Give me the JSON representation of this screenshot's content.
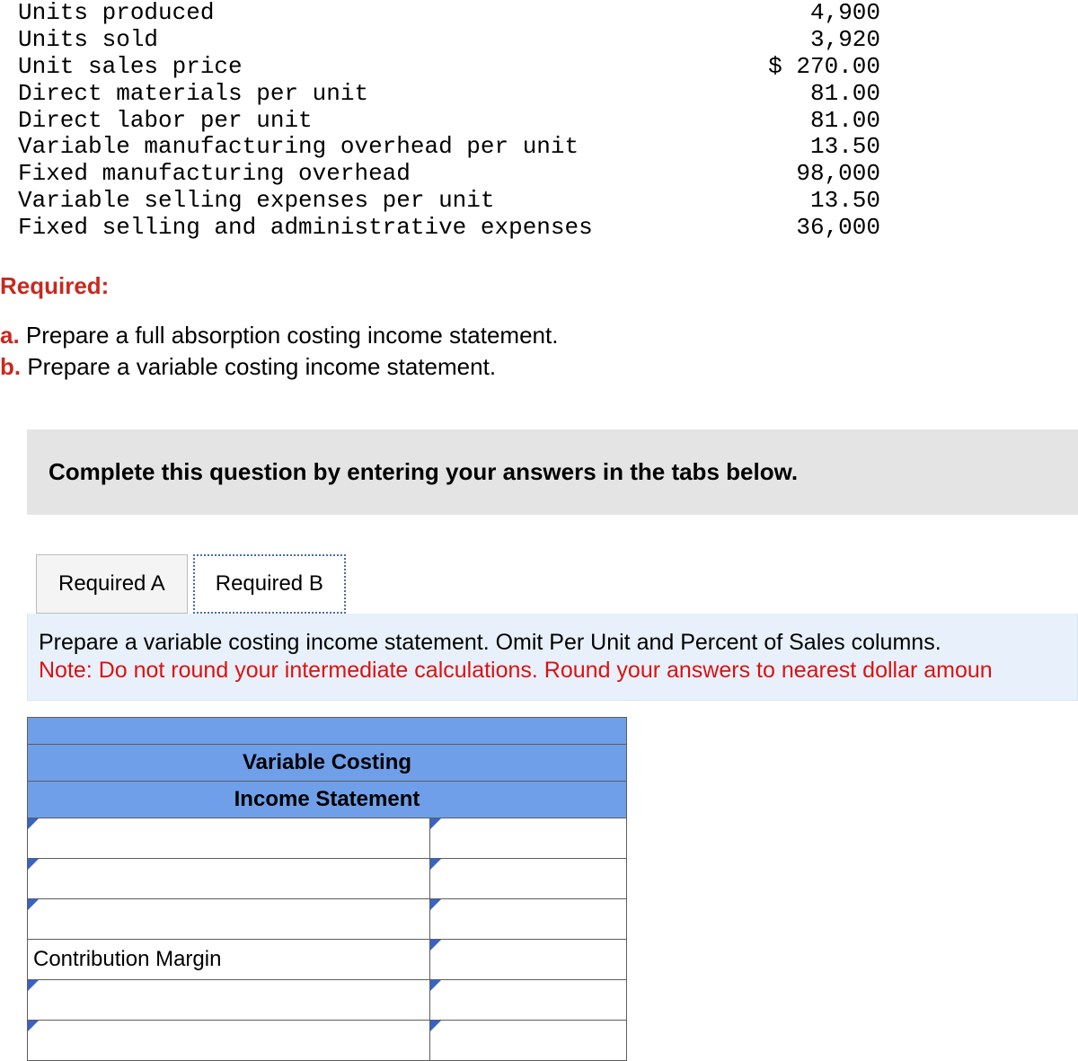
{
  "data_rows": [
    {
      "label": "Units produced",
      "value": "4,900"
    },
    {
      "label": "Units sold",
      "value": "3,920"
    },
    {
      "label": "Unit sales price",
      "value": "$ 270.00"
    },
    {
      "label": "Direct materials per unit",
      "value": "81.00"
    },
    {
      "label": "Direct labor per unit",
      "value": "81.00"
    },
    {
      "label": "Variable manufacturing overhead per unit",
      "value": "13.50"
    },
    {
      "label": "Fixed manufacturing overhead",
      "value": "98,000"
    },
    {
      "label": "Variable selling expenses per unit",
      "value": "13.50"
    },
    {
      "label": "Fixed selling and administrative expenses",
      "value": "36,000"
    }
  ],
  "required": {
    "heading": "Required:",
    "a_lead": "a.",
    "a_text": " Prepare a full absorption costing income statement.",
    "b_lead": "b.",
    "b_text": " Prepare a variable costing income statement."
  },
  "instruction": "Complete this question by entering your answers in the tabs below.",
  "tabs": {
    "a": "Required A",
    "b": "Required B"
  },
  "sub": {
    "main": "Prepare a variable costing income statement. Omit Per Unit and Percent of Sales columns.",
    "note": "Note: Do not round your intermediate calculations. Round your answers to nearest dollar amoun"
  },
  "sheet": {
    "title1": "Variable Costing",
    "title2": "Income Statement",
    "contribution": "Contribution Margin"
  }
}
